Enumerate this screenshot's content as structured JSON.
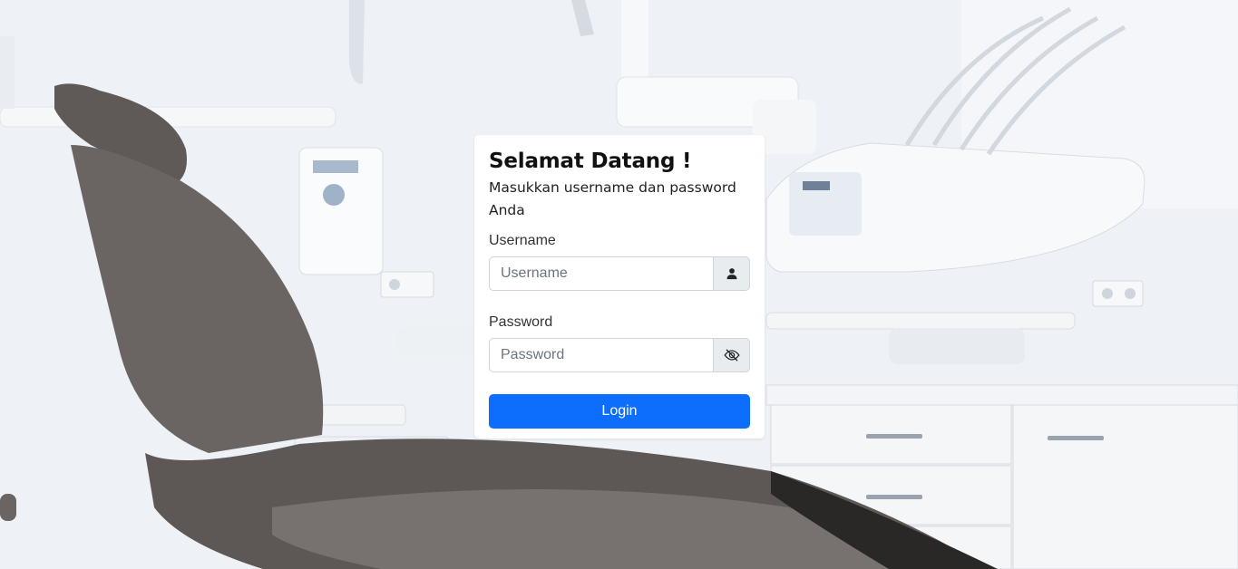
{
  "login": {
    "title": "Selamat Datang !",
    "subtitle": "Masukkan username dan password Anda",
    "username_label": "Username",
    "username_placeholder": "Username",
    "username_value": "",
    "password_label": "Password",
    "password_placeholder": "Password",
    "password_value": "",
    "submit_label": "Login"
  },
  "icons": {
    "username_addon": "person-icon",
    "password_addon": "eye-slash-icon"
  },
  "colors": {
    "primary": "#0d6efd",
    "addon_bg": "#e9ecef",
    "input_border": "#ced4da"
  }
}
